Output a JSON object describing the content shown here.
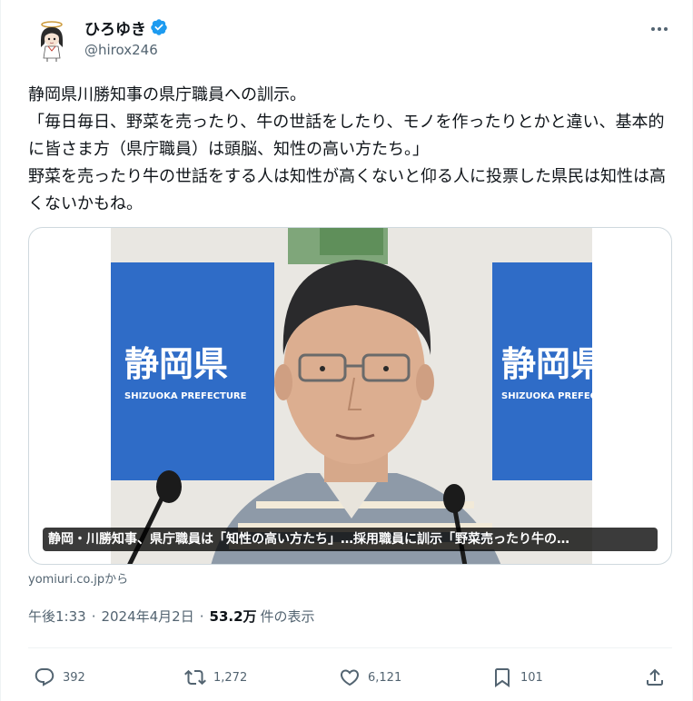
{
  "author": {
    "display_name": "ひろゆき",
    "handle": "@hirox246",
    "verified": true,
    "avatar": "anime-girl-avatar"
  },
  "tweet": {
    "text": "静岡県川勝知事の県庁職員への訓示。\n「毎日毎日、野菜を売ったり、牛の世話をしたり、モノを作ったりとかと違い、基本的に皆さま方（県庁職員）は頭脳、知性の高い方たち。」\n野菜を売ったり牛の世話をする人は知性が高くないと仰る人に投票した県民は知性は高くないかもね。"
  },
  "card": {
    "caption": "静岡・川勝知事、県庁職員は「知性の高い方たち」…採用職員に訓示「野菜売ったり牛の…",
    "sign_text": "静岡県",
    "sign_subtext": "SHIZUOKA PREFECTURE",
    "source": "yomiuri.co.jpから"
  },
  "meta": {
    "time": "午後1:33",
    "date": "2024年4月2日",
    "views_count": "53.2万",
    "views_label": "件の表示",
    "separator": "·"
  },
  "actions": {
    "replies": "392",
    "reposts": "1,272",
    "likes": "6,121",
    "bookmarks": "101"
  },
  "colors": {
    "text": "#0f1419",
    "secondary": "#536471",
    "verified": "#1d9bf0",
    "sign_blue": "#2f6cc7",
    "border": "#cfd9de"
  },
  "icons": {
    "more": "more-dots-icon",
    "reply": "speech-bubble-icon",
    "repost": "repost-arrows-icon",
    "like": "heart-icon",
    "bookmark": "bookmark-icon",
    "share": "share-upload-icon"
  }
}
